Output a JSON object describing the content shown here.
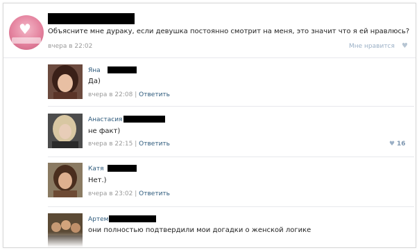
{
  "post": {
    "text": "Объясните мне дураку, если девушка постоянно смотрит на меня, это значит что я ей нравлюсь?",
    "time": "вчера в 22:02",
    "like_label": "Мне нравится",
    "like_icon": "heart-icon"
  },
  "comments": [
    {
      "name": "Яна",
      "text": "Да)",
      "time": "вчера в 22:08",
      "reply": "Ответить",
      "likes": ""
    },
    {
      "name": "Анастасия",
      "text": "не факт)",
      "time": "вчера в 22:15",
      "reply": "Ответить",
      "likes": "16"
    },
    {
      "name": "Катя",
      "text": "Нет.)",
      "time": "вчера в 23:02",
      "reply": "Ответить",
      "likes": ""
    },
    {
      "name": "Артем",
      "text": "они полностью подтвердили мои догадки о женской логике",
      "time": "",
      "reply": "",
      "likes": ""
    }
  ],
  "meta_separator": "|",
  "colors": {
    "link": "#2b587a",
    "muted": "#999999",
    "like": "#9bb0c6"
  }
}
